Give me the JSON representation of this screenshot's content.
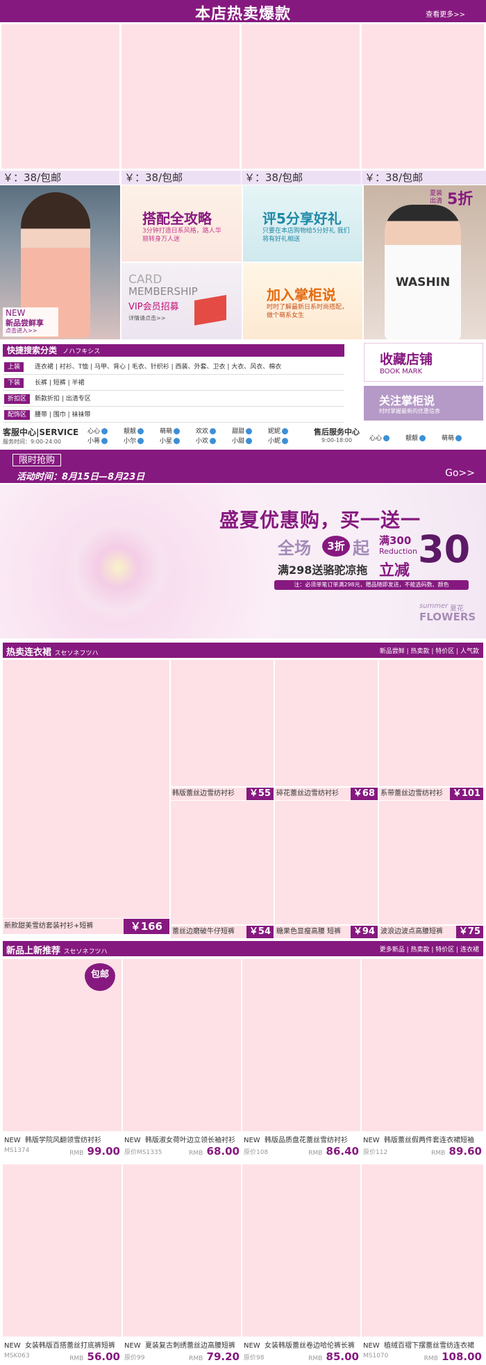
{
  "hot": {
    "title": "本店热卖爆款",
    "view_more": "查看更多>>",
    "prices": [
      "￥：38/包邮",
      "￥：38/包邮",
      "￥：38/包邮",
      "￥：38/包邮"
    ]
  },
  "promos": {
    "new_label": "NEW",
    "new_title": "新品尝鲜享",
    "new_link": "点击进入>>",
    "outfit_title": "搭配全攻略",
    "outfit_sub": "3分钟打造日系风格，路人华丽转身万人迷",
    "review_title": "评5分享好礼",
    "review_sub": "只要在本店购物给5分好礼 我们将有好礼相送",
    "card_title1": "CARD",
    "card_title2": "MEMBERSHIP",
    "card_vip": "VIP会员招募",
    "card_detail": "详情请点击>>",
    "join_title": "加入掌柜说",
    "join_sub": "时时了解最新日系时尚搭配，做个萌系女生",
    "sale_small1": "夏装",
    "sale_small2": "出清",
    "sale_big": "5折",
    "shirt_text": "WASHIN"
  },
  "quick": {
    "title": "快捷搜索分类",
    "subtitle": "ノハフキシス",
    "rows": [
      {
        "tag": "上装",
        "links": "连衣裙 | 衬衫、T恤 | 马甲、背心 | 毛衣、针织衫 | 西装、外套、卫衣 | 大衣、风衣、棉衣"
      },
      {
        "tag": "下装",
        "links": "长裤 | 短裤 | 半裙"
      },
      {
        "tag": "折扣区",
        "links": "新款折扣 | 出清专区"
      },
      {
        "tag": "配饰区",
        "links": "腰带 | 围巾 | 袜袜带"
      }
    ],
    "fav_title": "收藏店铺",
    "fav_sub": "BOOK MARK",
    "follow_title": "关注掌柜说",
    "follow_sub": "时时掌握最新的优惠信息"
  },
  "service": {
    "title": "客服中心|SERVICE",
    "hours": "服务时间：9:00-24:00",
    "agents_row1": [
      "心心",
      "靓靓",
      "萌萌",
      "欢欢",
      "甜甜",
      "妮妮"
    ],
    "agents_row2": [
      "小蒋",
      "小尔",
      "小星",
      "小欢",
      "小甜",
      "小妮"
    ],
    "after_title": "售后服务中心",
    "after_hours": "9:00-18:00",
    "after_agents": [
      "心心",
      "靓靓",
      "萌萌"
    ]
  },
  "flash": {
    "tag": "限时抢购",
    "time": "活动时间：8月15日—8月23日",
    "go": "Go>>"
  },
  "banner": {
    "headline": "盛夏优惠购，买一送一",
    "all_store": "全场",
    "discount": "3折",
    "qi": "起",
    "full300": "满300",
    "reduction": "Reduction",
    "big30": "30",
    "lijian": "立减",
    "gift": "满298送骆驼凉拖",
    "note": "注：必须单笔订单满298元，赠品随即发送，不能选码数、颜色",
    "summer": "summer",
    "xiahua": "夏花",
    "flowers": "FLOWERS"
  },
  "dresses": {
    "title": "热卖连衣裙",
    "subtitle": "スセソネフツハ",
    "links": "新品尝鲜 | 热卖款 | 特价区 | 人气款",
    "items": [
      {
        "name": "新款甜美雪纺套装衬衫+短裤",
        "price": "￥166"
      },
      {
        "name": "韩版蕾丝边雪纺衬衫",
        "price": "￥55"
      },
      {
        "name": "碎花蕾丝边雪纺衬衫",
        "price": "￥68"
      },
      {
        "name": "系带蕾丝边雪纺衬衫",
        "price": "￥101"
      },
      {
        "name": "蕾丝边磨破牛仔短裤",
        "price": "￥54"
      },
      {
        "name": "糖果色显瘦高腰 短裤",
        "price": "￥94"
      },
      {
        "name": "波浪边波点高腰短裤",
        "price": "￥75"
      }
    ]
  },
  "newarrivals": {
    "title": "新品上新推荐",
    "subtitle": "スセソネフツハ",
    "links": "更多新品 | 热卖款 | 特价区 | 连衣裙",
    "badge": "包邮",
    "items": [
      {
        "new": "NEW",
        "name": "韩版学院风翻领雪纺衬衫",
        "code": "MS1374",
        "rmb": "RMB",
        "price": "99.00"
      },
      {
        "new": "NEW",
        "name": "韩版淑女荷叶边立领长袖衬衫",
        "code": "原价MS1335",
        "rmb": "RMB",
        "price": "68.00"
      },
      {
        "new": "NEW",
        "name": "韩版品质盘花蕾丝雪纺衬衫",
        "code": "原价108",
        "rmb": "RMB",
        "price": "86.40"
      },
      {
        "new": "NEW",
        "name": "韩版蕾丝假两件套连衣裙短袖",
        "code": "原价112",
        "rmb": "RMB",
        "price": "89.60"
      },
      {
        "new": "NEW",
        "name": "女装韩版百搭蕾丝打底裤短裤",
        "code": "MSK063",
        "rmb": "RMB",
        "price": "56.00"
      },
      {
        "new": "NEW",
        "name": "夏装复古刺绣蕾丝边高腰短裤",
        "code": "原价99",
        "rmb": "RMB",
        "price": "79.20"
      },
      {
        "new": "NEW",
        "name": "女装韩版蕾丝卷边哈伦裤长裤",
        "code": "原价98",
        "rmb": "RMB",
        "price": "85.00"
      },
      {
        "new": "NEW",
        "name": "植绒百褶下摆蕾丝雪纺连衣裙",
        "code": "MS1070",
        "rmb": "RMB",
        "price": "108.00"
      }
    ]
  }
}
